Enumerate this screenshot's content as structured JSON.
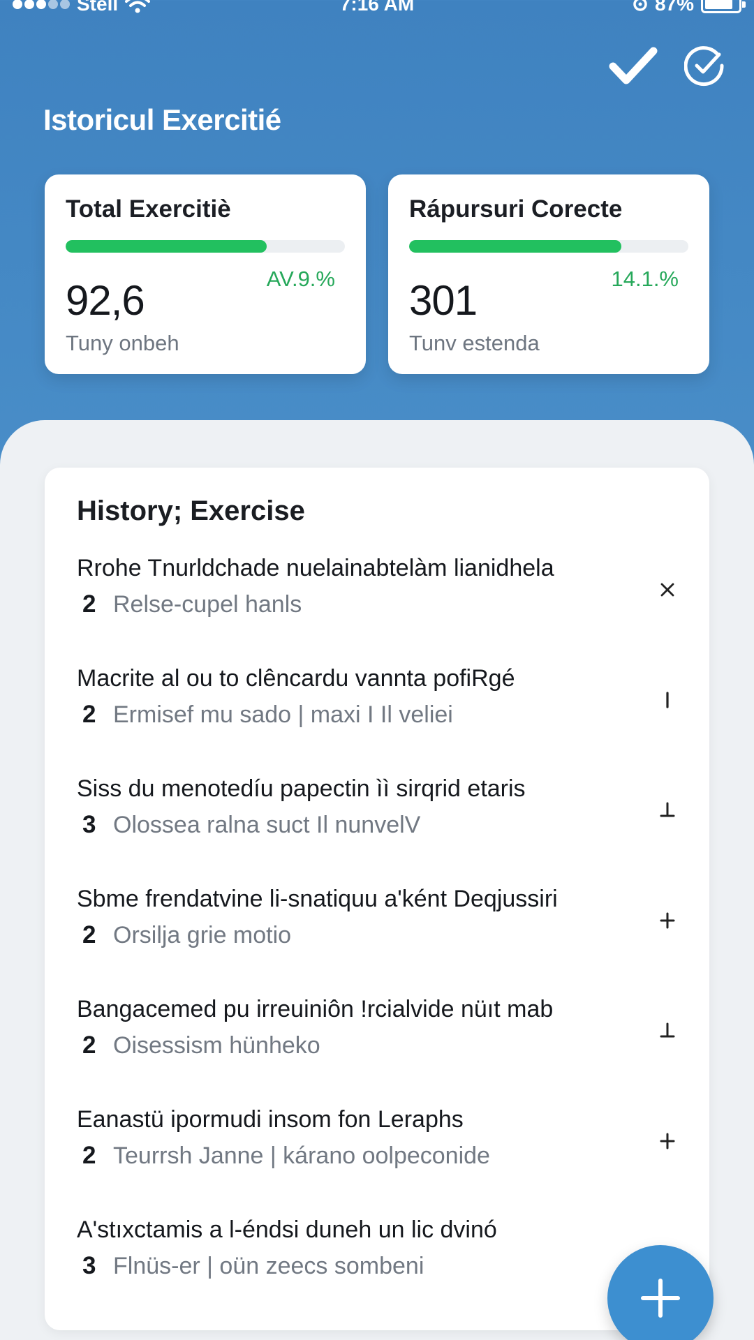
{
  "status_bar": {
    "carrier": "Stell",
    "time": "7:16 AM",
    "battery_text": "87%",
    "battery_level": 0.87
  },
  "header": {
    "title": "Istoricul Exercitié",
    "actions": [
      {
        "icon": "checkmark-icon"
      },
      {
        "icon": "check-circle-icon"
      }
    ]
  },
  "stats": [
    {
      "title": "Total Exercitiè",
      "value": "92,6",
      "delta": "AV.9.%",
      "caption": "Tuny onbeh",
      "progress": 0.72
    },
    {
      "title": "Rápursuri Corecte",
      "value": "301",
      "delta": "14.1.%",
      "caption": "Tunv estenda",
      "progress": 0.76
    }
  ],
  "history": {
    "title": "History; Exercise",
    "items": [
      {
        "title": "Rrohe Tnurldchade nuelainabtelàm lianidhela",
        "count": "2",
        "detail": "Relse-cupel hanls",
        "action_icon": "close-icon"
      },
      {
        "title": "Macrite al ou to clêncardu vannta pofiRgé",
        "count": "2",
        "detail": "Ermisef mu sado | maxi I Il veliei",
        "action_icon": "bar-icon"
      },
      {
        "title": "Siss du menotedíu papectin ìì sirqrid etaris",
        "count": "3",
        "detail": "Olossea ralna suct Il nunvelV",
        "action_icon": "up-tack-icon"
      },
      {
        "title": "Sbme frendatvine li-snatiquu a'ként Deqjussiri",
        "count": "2",
        "detail": "Orsilja grie motio",
        "action_icon": "plus-icon"
      },
      {
        "title": "Bangacemed pu irreuiniôn !rcialvide nüıt mab",
        "count": "2",
        "detail": "Oisessism hünheko",
        "action_icon": "up-tack-icon"
      },
      {
        "title": "Eanastü ipormudi insom fon Leraphs",
        "count": "2",
        "detail": "Teurrsh Janne | kárano oolpeconide",
        "action_icon": "plus-icon"
      },
      {
        "title": "A'stıxctamis a l-éndsi duneh un lic dvinó",
        "count": "3",
        "detail": "Flnüs-er | oün zeecs sombeni",
        "action_icon": ""
      }
    ]
  },
  "fab": {
    "icon": "plus-icon"
  },
  "colors": {
    "header_bg": "#3f82c0",
    "accent_green": "#22c05f",
    "delta_green": "#26a85a",
    "fab_blue": "#3d8fd0",
    "sheet_bg": "#eef1f4"
  }
}
